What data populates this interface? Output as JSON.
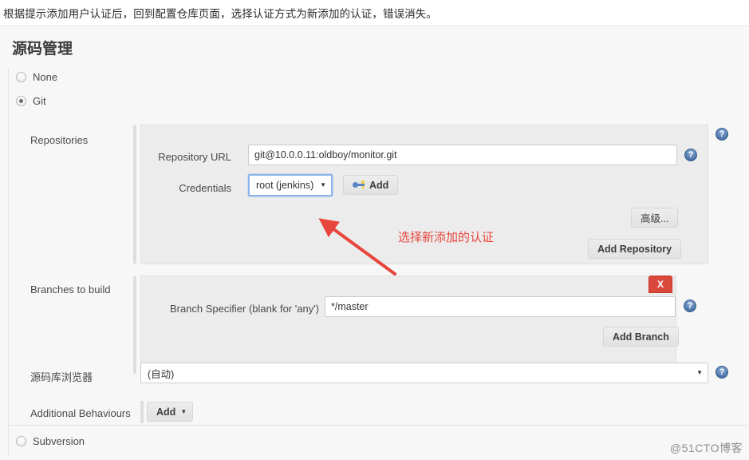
{
  "caption": {
    "text": "根据提示添加用户认证后，回到配置仓库页面，选择认证方式为新添加的认证，错误消失。"
  },
  "page": {
    "title": "源码管理",
    "watermark": "@51CTO博客"
  },
  "scm_options": [
    {
      "label": "None",
      "selected": false
    },
    {
      "label": "Git",
      "selected": true
    },
    {
      "label": "Subversion",
      "selected": false
    }
  ],
  "repositories": {
    "section_label": "Repositories",
    "repository_url": {
      "label": "Repository URL",
      "value": "git@10.0.0.11:oldboy/monitor.git"
    },
    "credentials": {
      "label": "Credentials",
      "value": "root (jenkins)",
      "caret": "▼",
      "add_button": "Add"
    },
    "advanced_button": "高级...",
    "add_repository_button": "Add Repository"
  },
  "branches": {
    "section_label": "Branches to build",
    "branch_specifier": {
      "label": "Branch Specifier (blank for 'any')",
      "value": "*/master"
    },
    "delete_button": "X",
    "add_branch_button": "Add Branch"
  },
  "repo_browser": {
    "label": "源码库浏览器",
    "value": "(自动)",
    "caret": "▼"
  },
  "additional_behaviours": {
    "label": "Additional Behaviours",
    "add_button": "Add",
    "caret": "▼"
  },
  "help_icons": {
    "glyph": "?"
  },
  "annotation": {
    "text": "选择新添加的认证",
    "color": "#e8453c"
  }
}
